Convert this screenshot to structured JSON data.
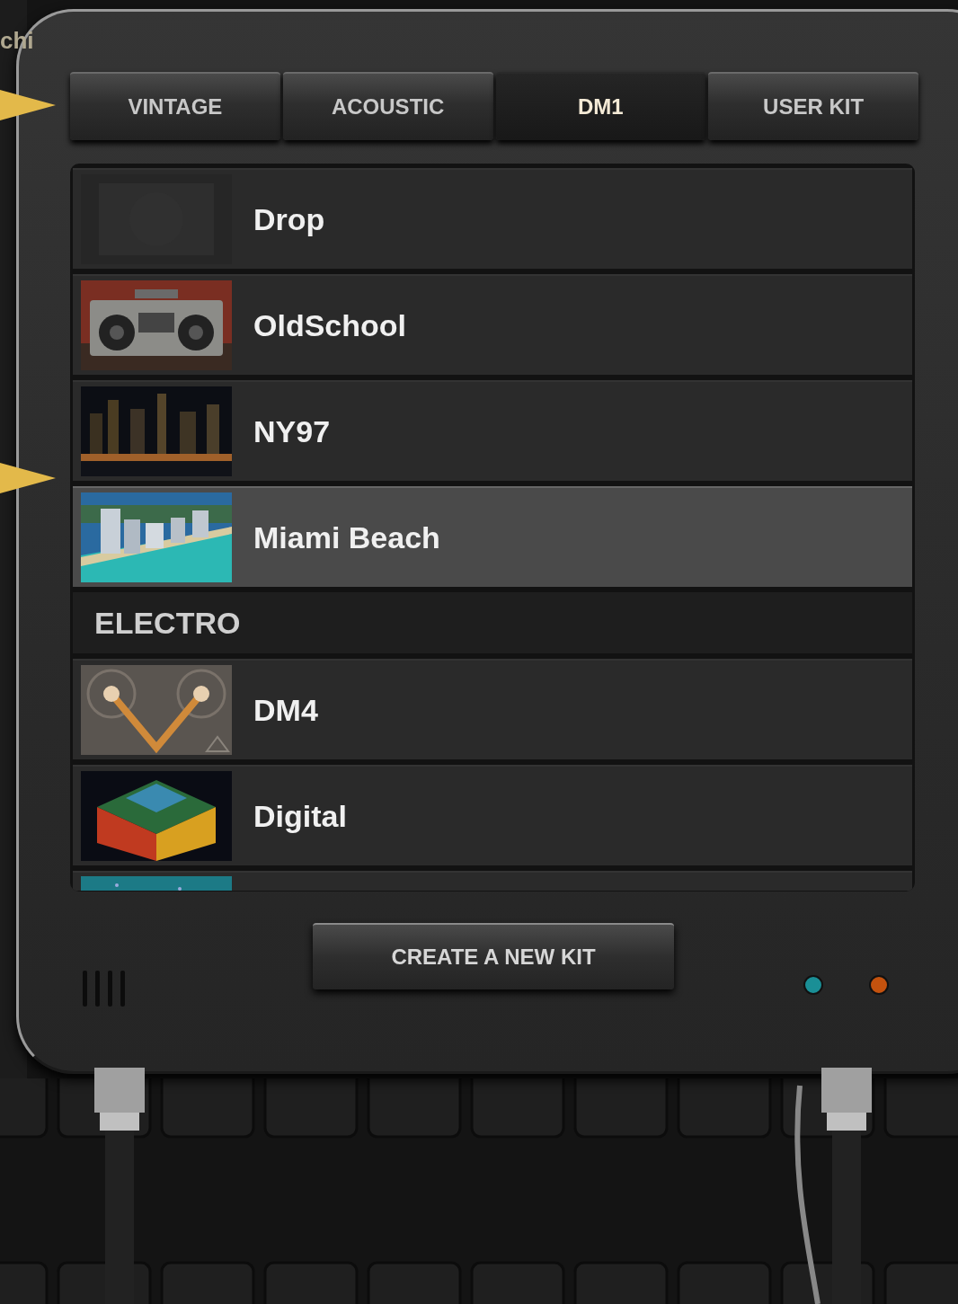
{
  "background_label": "chi",
  "tabs": [
    {
      "label": "VINTAGE",
      "selected": false
    },
    {
      "label": "ACOUSTIC",
      "selected": false
    },
    {
      "label": "DM1",
      "selected": true
    },
    {
      "label": "USER KIT",
      "selected": false
    }
  ],
  "kits": [
    {
      "kind": "kit",
      "name": "Drop",
      "selected": false
    },
    {
      "kind": "kit",
      "name": "OldSchool",
      "selected": false
    },
    {
      "kind": "kit",
      "name": "NY97",
      "selected": false
    },
    {
      "kind": "kit",
      "name": "Miami Beach",
      "selected": true
    },
    {
      "kind": "section",
      "name": "ELECTRO"
    },
    {
      "kind": "kit",
      "name": "DM4",
      "selected": false
    },
    {
      "kind": "kit",
      "name": "Digital",
      "selected": false
    },
    {
      "kind": "kit",
      "selected": false
    }
  ],
  "create_button": "CREATE A NEW KIT",
  "lights": [
    {
      "color": "#1a8f96"
    },
    {
      "color": "#c4520e"
    }
  ]
}
